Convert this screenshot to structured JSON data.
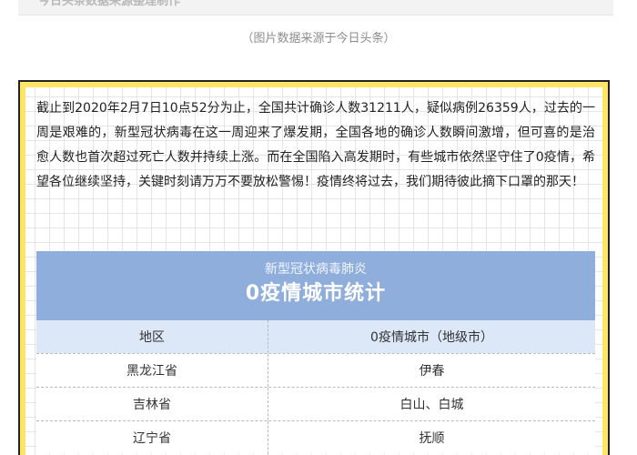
{
  "top_banner": {
    "text": "今日头条数据来源整理制作"
  },
  "source_caption": "（图片数据来源于今日头条）",
  "intro_text": "截止到2020年2月7日10点52分为止，全国共计确诊人数31211人，疑似病例26359人，过去的一周是艰难的，新型冠状病毒在这一周迎来了爆发期，全国各地的确诊人数瞬间激增，但可喜的是治愈人数也首次超过死亡人数并持续上涨。而在全国陷入高发期时，有些城市依然坚守住了0疫情，希望各位继续坚持，关键时刻请万万不要放松警惕！疫情终将过去，我们期待彼此摘下口罩的那天！",
  "table": {
    "subtitle": "新型冠状病毒肺炎",
    "title": "0疫情城市统计",
    "columns": [
      "地区",
      "0疫情城市（地级市）"
    ],
    "rows": [
      {
        "region": "黑龙江省",
        "cities": "伊春"
      },
      {
        "region": "吉林省",
        "cities": "白山、白城"
      },
      {
        "region": "辽宁省",
        "cities": "抚顺"
      }
    ]
  },
  "colors": {
    "frame_yellow": "#ffe566",
    "table_header_blue": "#8faedb",
    "column_header_bg": "#dce7f7"
  }
}
